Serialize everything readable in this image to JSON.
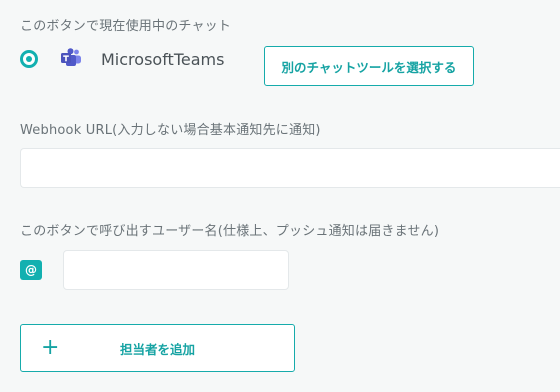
{
  "current_chat": {
    "label": "このボタンで現在使用中のチャット",
    "name": "MicrosoftTeams",
    "icon": "microsoft-teams-icon",
    "selected": true
  },
  "select_tool_button": {
    "label": "別のチャットツールを選択する"
  },
  "webhook": {
    "label": "Webhook URL(入力しない場合基本通知先に通知)",
    "value": "",
    "placeholder": ""
  },
  "mention": {
    "label": "このボタンで呼び出すユーザー名(仕様上、プッシュ通知は届きません)",
    "badge": "@",
    "value": "",
    "placeholder": ""
  },
  "add_assignee_button": {
    "icon": "+",
    "label": "担当者を追加"
  },
  "colors": {
    "accent": "#12b0b0",
    "label_text": "#6a7378",
    "background": "#f6f8f8",
    "teams_purple": "#5059c9"
  }
}
